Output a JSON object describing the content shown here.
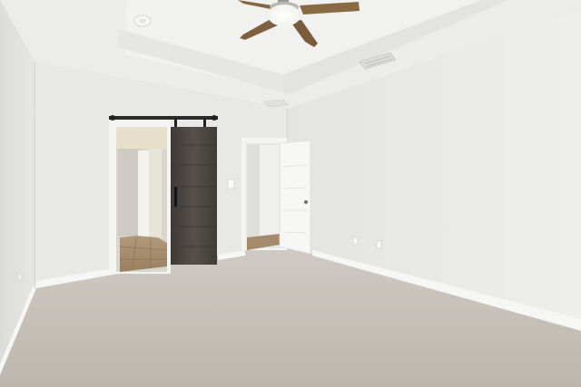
{
  "scene": {
    "description": "",
    "colors": {
      "wall": "#e9e9e8",
      "ceiling": "#ececea",
      "carpet": "#c9c3bc",
      "trim": "#f5f5f3",
      "barn_door": "#4a4640",
      "tile": "#a88e6e",
      "fan_blade": "#8a6a44"
    },
    "icons": {
      "ceiling_fan": "ceiling-fan-icon",
      "smoke_detector": "smoke-detector-icon",
      "vent": "air-vent-icon",
      "light_switch": "light-switch-icon",
      "outlet": "outlet-icon"
    }
  }
}
